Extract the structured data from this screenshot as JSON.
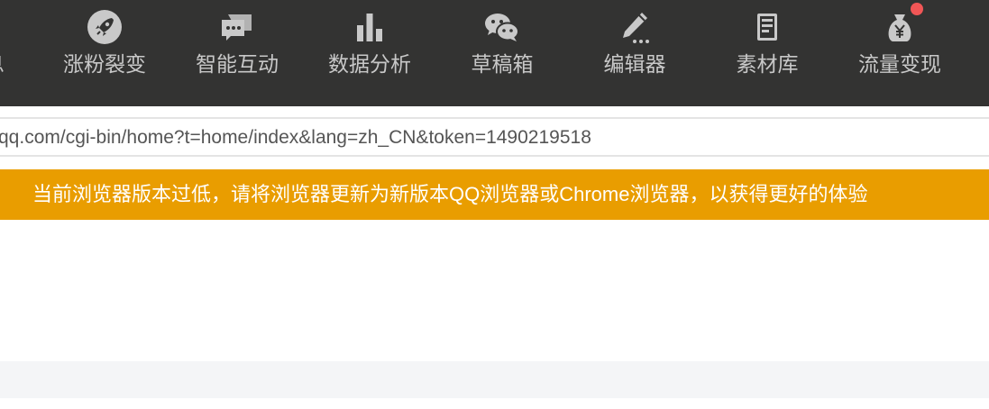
{
  "toolbar": {
    "partial_label": "息",
    "items": [
      {
        "label": "涨粉裂变",
        "icon": "rocket-icon"
      },
      {
        "label": "智能互动",
        "icon": "chat-bubbles-icon"
      },
      {
        "label": "数据分析",
        "icon": "bar-chart-icon"
      },
      {
        "label": "草稿箱",
        "icon": "wechat-icon"
      },
      {
        "label": "编辑器",
        "icon": "pencil-icon"
      },
      {
        "label": "素材库",
        "icon": "book-icon"
      },
      {
        "label": "流量变现",
        "icon": "money-bag-icon"
      }
    ]
  },
  "urlbar": {
    "text": "qq.com/cgi-bin/home?t=home/index&lang=zh_CN&token=1490219518"
  },
  "banner": {
    "text": "当前浏览器版本过低，请将浏览器更新为新版本QQ浏览器或Chrome浏览器，以获得更好的体验"
  },
  "colors": {
    "toolbar_bg": "#333332",
    "banner_bg": "#e99d00",
    "notification_dot": "#f15656"
  }
}
